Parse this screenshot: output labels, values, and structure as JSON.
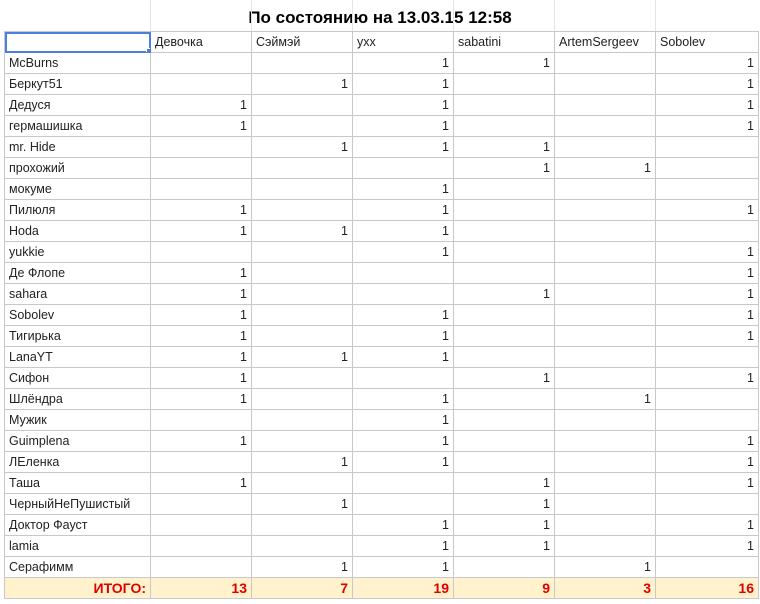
{
  "sheet": {
    "title": "По состоянию на 13.03.15 12:58",
    "columns": [
      "",
      "Девочка",
      "Сэймэй",
      "yxx",
      "sabatini",
      "ArtemSergeev",
      "Sobolev"
    ],
    "rows": [
      {
        "name": "McBurns",
        "cells": [
          "",
          "",
          "1",
          "1",
          "",
          "1"
        ]
      },
      {
        "name": "Беркут51",
        "cells": [
          "",
          "1",
          "1",
          "",
          "",
          "1"
        ]
      },
      {
        "name": "Дедуся",
        "cells": [
          "1",
          "",
          "1",
          "",
          "",
          "1"
        ]
      },
      {
        "name": "гермашишка",
        "cells": [
          "1",
          "",
          "1",
          "",
          "",
          "1"
        ]
      },
      {
        "name": "mr. Hide",
        "cells": [
          "",
          "1",
          "1",
          "1",
          "",
          ""
        ]
      },
      {
        "name": "прохожий",
        "cells": [
          "",
          "",
          "",
          "1",
          "1",
          ""
        ]
      },
      {
        "name": "мокуме",
        "cells": [
          "",
          "",
          "1",
          "",
          "",
          ""
        ]
      },
      {
        "name": "Пилюля",
        "cells": [
          "1",
          "",
          "1",
          "",
          "",
          "1"
        ]
      },
      {
        "name": "Hoda",
        "cells": [
          "1",
          "1",
          "1",
          "",
          "",
          ""
        ]
      },
      {
        "name": "yukkie",
        "cells": [
          "",
          "",
          "1",
          "",
          "",
          "1"
        ]
      },
      {
        "name": "Де Флопе",
        "cells": [
          "1",
          "",
          "",
          "",
          "",
          "1"
        ]
      },
      {
        "name": "sahara",
        "cells": [
          "1",
          "",
          "",
          "1",
          "",
          "1"
        ]
      },
      {
        "name": "Sobolev",
        "cells": [
          "1",
          "",
          "1",
          "",
          "",
          "1"
        ]
      },
      {
        "name": "Тигирька",
        "cells": [
          "1",
          "",
          "1",
          "",
          "",
          "1"
        ]
      },
      {
        "name": "LanaYT",
        "cells": [
          "1",
          "1",
          "1",
          "",
          "",
          ""
        ]
      },
      {
        "name": "Сифон",
        "cells": [
          "1",
          "",
          "",
          "1",
          "",
          "1"
        ]
      },
      {
        "name": "Шлёндра",
        "cells": [
          "1",
          "",
          "1",
          "",
          "1",
          ""
        ]
      },
      {
        "name": "Мужик",
        "cells": [
          "",
          "",
          "1",
          "",
          "",
          ""
        ]
      },
      {
        "name": "Guimplena",
        "cells": [
          "1",
          "",
          "1",
          "",
          "",
          "1"
        ]
      },
      {
        "name": "ЛЕленка",
        "cells": [
          "",
          "1",
          "1",
          "",
          "",
          "1"
        ]
      },
      {
        "name": "Таша",
        "cells": [
          "1",
          "",
          "",
          "1",
          "",
          "1"
        ]
      },
      {
        "name": "ЧерныйНеПушистый",
        "cells": [
          "",
          "1",
          "",
          "1",
          "",
          ""
        ]
      },
      {
        "name": "Доктор Фауст",
        "cells": [
          "",
          "",
          "1",
          "1",
          "",
          "1"
        ]
      },
      {
        "name": "lamia",
        "cells": [
          "",
          "",
          "1",
          "1",
          "",
          "1"
        ]
      },
      {
        "name": "Серафимм",
        "cells": [
          "",
          "1",
          "1",
          "",
          "1",
          ""
        ]
      }
    ],
    "total": {
      "label": "ИТОГО:",
      "values": [
        "13",
        "7",
        "19",
        "9",
        "3",
        "16"
      ]
    },
    "colors": {
      "total_bg": "#fff2cc",
      "total_text": "#e00000",
      "selection": "#4a7fe0",
      "grid": "#c8c8c8"
    }
  }
}
